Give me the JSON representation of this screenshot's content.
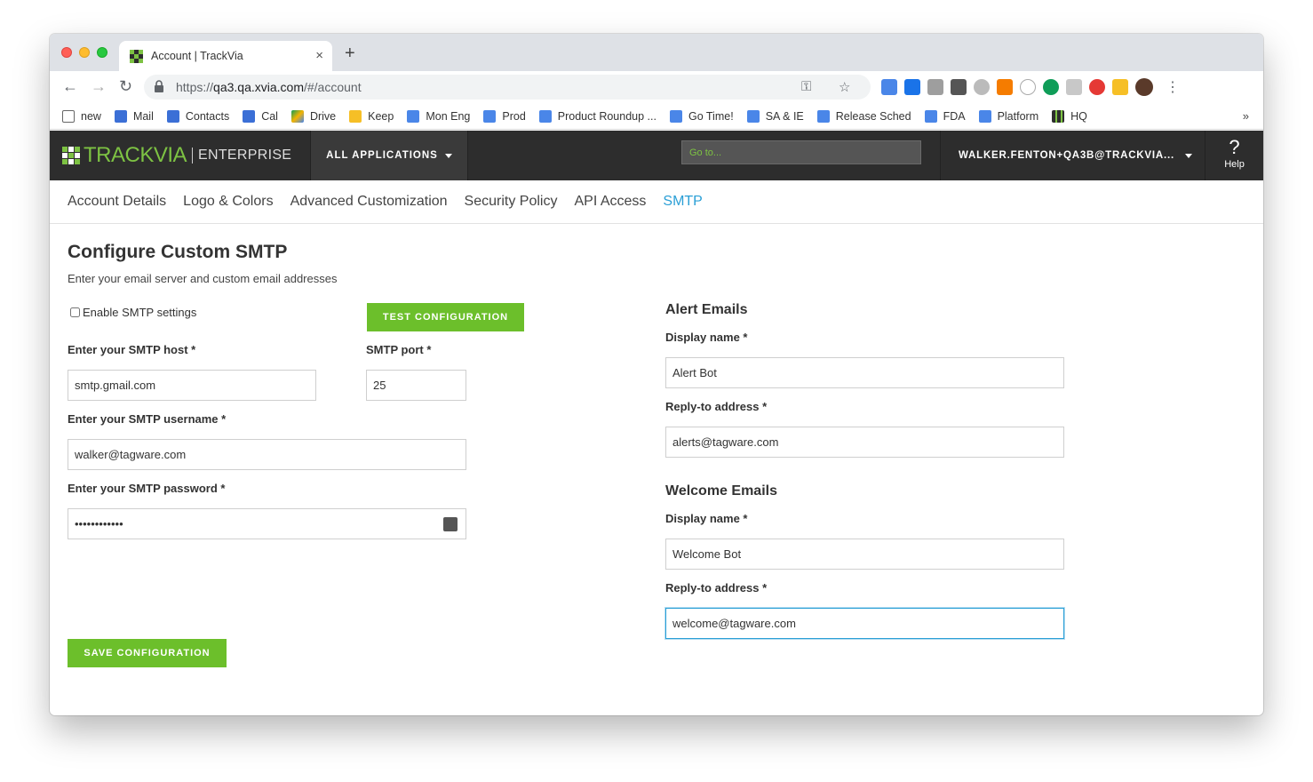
{
  "browser": {
    "tab_title": "Account | TrackVia",
    "tab_close": "×",
    "new_tab": "+",
    "url_prefix": "https://",
    "url_host": "qa3.qa.xvia.com",
    "url_path": "/#/account",
    "back": "←",
    "forward": "→",
    "reload": "↻",
    "key_icon": "⚿",
    "star_icon": "☆",
    "menu_icon": "⋮",
    "bookmarks_more": "»",
    "bookmarks": [
      {
        "label": "new",
        "icon": "folder-icon",
        "color": "#666666"
      },
      {
        "label": "Mail",
        "icon": "mail-icon",
        "color": "#3b6fd6"
      },
      {
        "label": "Contacts",
        "icon": "contacts-icon",
        "color": "#3b6fd6"
      },
      {
        "label": "Cal",
        "icon": "calendar-icon",
        "color": "#3b6fd6"
      },
      {
        "label": "Drive",
        "icon": "drive-icon",
        "color": "#f4b400"
      },
      {
        "label": "Keep",
        "icon": "keep-icon",
        "color": "#f6bf26"
      },
      {
        "label": "Mon Eng",
        "icon": "doc-icon",
        "color": "#4a86e8"
      },
      {
        "label": "Prod",
        "icon": "doc-icon",
        "color": "#4a86e8"
      },
      {
        "label": "Product Roundup ...",
        "icon": "doc-icon",
        "color": "#4a86e8"
      },
      {
        "label": "Go Time!",
        "icon": "doc-icon",
        "color": "#4a86e8"
      },
      {
        "label": "SA & IE",
        "icon": "doc-icon",
        "color": "#4a86e8"
      },
      {
        "label": "Release Sched",
        "icon": "doc-icon",
        "color": "#4a86e8"
      },
      {
        "label": "FDA",
        "icon": "doc-icon",
        "color": "#4a86e8"
      },
      {
        "label": "Platform",
        "icon": "doc-icon",
        "color": "#4a86e8"
      },
      {
        "label": "HQ",
        "icon": "trackvia-icon",
        "color": "#2d2d2d"
      }
    ]
  },
  "header": {
    "logo_text": "TRACKVIA",
    "logo_edition": "ENTERPRISE",
    "all_apps": "ALL APPLICATIONS",
    "goto_placeholder": "Go to...",
    "user": "WALKER.FENTON+QA3B@TRACKVIA...",
    "help_symbol": "?",
    "help_label": "Help"
  },
  "subnav": [
    {
      "label": "Account Details",
      "active": false
    },
    {
      "label": "Logo & Colors",
      "active": false
    },
    {
      "label": "Advanced Customization",
      "active": false
    },
    {
      "label": "Security Policy",
      "active": false
    },
    {
      "label": "API Access",
      "active": false
    },
    {
      "label": "SMTP",
      "active": true
    }
  ],
  "form": {
    "title": "Configure Custom SMTP",
    "subtitle": "Enter your email server and custom email addresses",
    "enable_label": "Enable SMTP settings",
    "test_button": "TEST CONFIGURATION",
    "host_label": "Enter your SMTP host *",
    "host_value": "smtp.gmail.com",
    "port_label": "SMTP port *",
    "port_value": "25",
    "username_label": "Enter your SMTP username *",
    "username_value": "walker@tagware.com",
    "password_label": "Enter your SMTP password *",
    "password_value": "••••••••••••",
    "save_button": "SAVE CONFIGURATION"
  },
  "alert_emails": {
    "title": "Alert Emails",
    "display_label": "Display name *",
    "display_value": "Alert Bot",
    "reply_label": "Reply-to address *",
    "reply_value": "alerts@tagware.com"
  },
  "welcome_emails": {
    "title": "Welcome Emails",
    "display_label": "Display name *",
    "display_value": "Welcome Bot",
    "reply_label": "Reply-to address *",
    "reply_value": "welcome@tagware.com"
  },
  "colors": {
    "accent_green": "#6cbf2b",
    "link_blue": "#2a9fd6",
    "header_dark": "#2d2d2d"
  }
}
